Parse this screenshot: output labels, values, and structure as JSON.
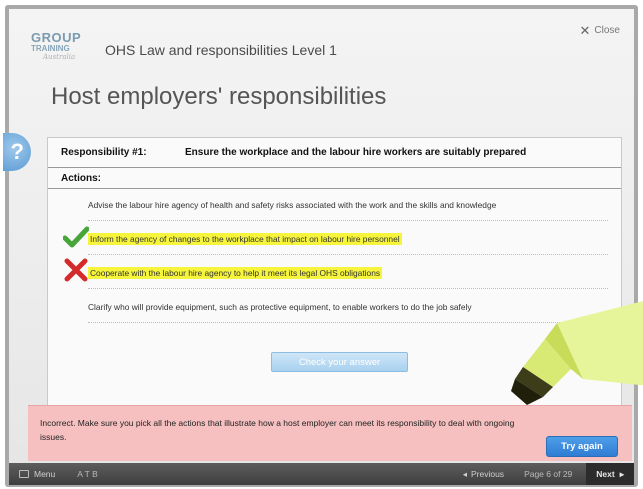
{
  "logo": {
    "line1": "GROUP",
    "line2": "TRAINING",
    "line3": "Australia"
  },
  "course_title": "OHS Law and responsibilities Level 1",
  "close_label": "Close",
  "help_label": "?",
  "page_title": "Host employers' responsibilities",
  "card": {
    "responsibility_label": "Responsibility #1:",
    "responsibility_text": "Ensure the workplace and the labour hire workers are suitably prepared",
    "actions_label": "Actions:",
    "actions": [
      {
        "text": "Advise the labour hire agency of health and safety risks associated with the work and the skills and knowledge",
        "highlighted": false,
        "mark": "none"
      },
      {
        "text": "Inform the agency of changes to the workplace that impact on labour hire personnel",
        "highlighted": true,
        "mark": "check"
      },
      {
        "text": "Cooperate with the labour hire agency to help it meet its legal OHS obligations",
        "highlighted": true,
        "mark": "cross"
      },
      {
        "text": "Clarify who will provide equipment, such as protective equipment, to enable workers to do the job safely",
        "highlighted": false,
        "mark": "none"
      }
    ],
    "check_button": "Check your answer"
  },
  "feedback": {
    "message": "Incorrect. Make sure you pick all the actions that illustrate how a host employer can meet its responsibility to deal with ongoing issues.",
    "try_again": "Try again"
  },
  "footer": {
    "menu_label": "Menu",
    "tools_label": "A  T  B",
    "previous_label": "Previous",
    "page_indicator": "Page 6 of 29",
    "next_label": "Next"
  },
  "colors": {
    "highlight": "#f6f53b",
    "feedback_bg": "#f6c0c0",
    "primary_button": "#2f7dd3",
    "check": "#47a53a",
    "cross": "#d42a2a"
  }
}
